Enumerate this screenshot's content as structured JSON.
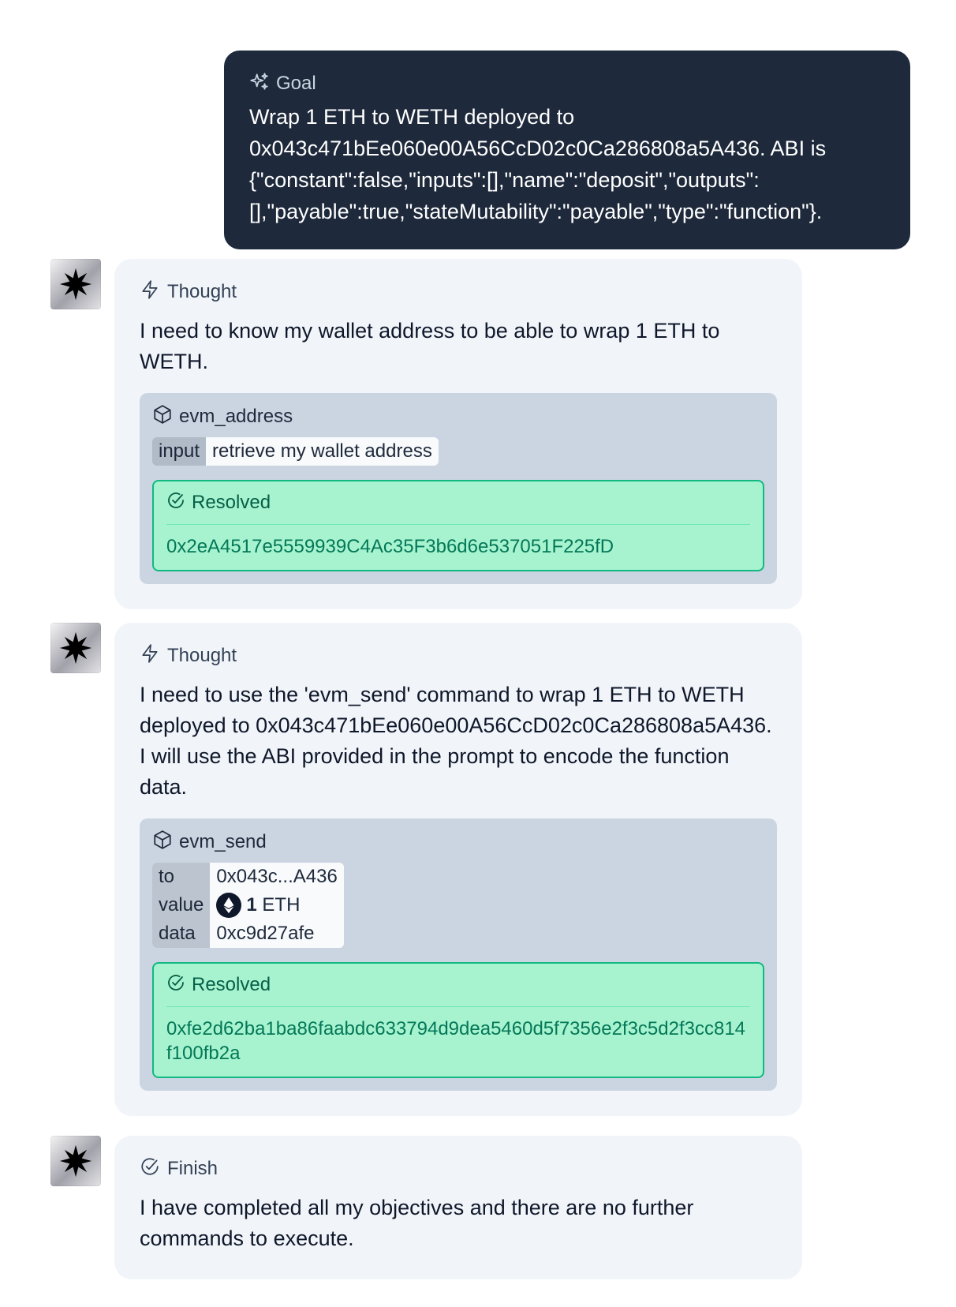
{
  "goal": {
    "label": "Goal",
    "icon": "sparkles-icon",
    "text": "Wrap 1 ETH to WETH deployed to 0x043c471bEe060e00A56CcD02c0Ca286808a5A436. ABI is {\"constant\":false,\"inputs\":[],\"name\":\"deposit\",\"outputs\":[],\"payable\":true,\"stateMutability\":\"payable\",\"type\":\"function\"}."
  },
  "steps": [
    {
      "type_label": "Thought",
      "icon": "lightning-icon",
      "text": "I need to know my wallet address to be able to wrap 1 ETH to WETH.",
      "tool": {
        "name": "evm_address",
        "icon": "cube-icon",
        "args": [
          {
            "key": "input",
            "value": "retrieve my wallet address"
          }
        ],
        "resolved_label": "Resolved",
        "resolved_value": "0x2eA4517e5559939C4Ac35F3b6d6e537051F225fD"
      }
    },
    {
      "type_label": "Thought",
      "icon": "lightning-icon",
      "text": "I need to use the 'evm_send' command to wrap 1 ETH to WETH deployed to 0x043c471bEe060e00A56CcD02c0Ca286808a5A436. I will use the ABI provided in the prompt to encode the function data.",
      "tool": {
        "name": "evm_send",
        "icon": "cube-icon",
        "args": [
          {
            "key": "to",
            "value": "0x043c...A436"
          },
          {
            "key": "value",
            "amount": "1",
            "unit": "ETH",
            "icon": "ethereum-icon"
          },
          {
            "key": "data",
            "value": "0xc9d27afe"
          }
        ],
        "resolved_label": "Resolved",
        "resolved_value": "0xfe2d62ba1ba86faabdc633794d9dea5460d5f7356e2f3c5d2f3cc814f100fb2a"
      }
    },
    {
      "type_label": "Finish",
      "icon": "check-circle-icon",
      "text": "I have completed all my objectives and there are no further commands to execute."
    }
  ],
  "colors": {
    "goal_bg": "#1e293b",
    "card_bg": "#f1f5f9",
    "tool_bg": "#cbd5e1",
    "resolved_bg": "#a7f3d0",
    "resolved_border": "#10b981",
    "resolved_text": "#047857"
  }
}
